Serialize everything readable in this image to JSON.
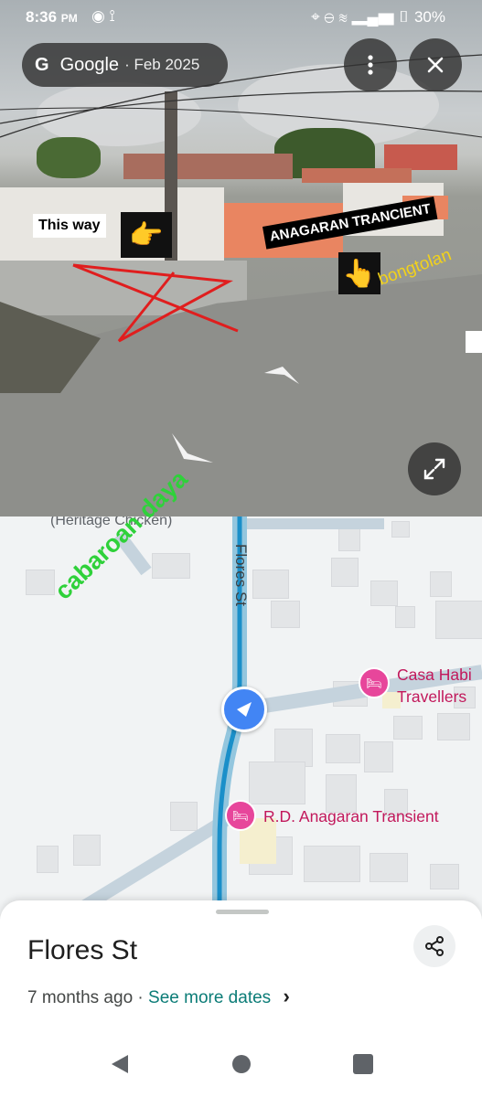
{
  "status_bar": {
    "time": "8:36",
    "ampm": "PM",
    "battery": "30%"
  },
  "street_view": {
    "brand": "Google",
    "date": "· Feb 2025",
    "menu_icon": "more-vertical-icon",
    "close_icon": "close-icon",
    "fullscreen_icon": "expand-icon",
    "annotations": {
      "this_way": "This way",
      "anagaran": "ANAGARAN TRANCIENT",
      "bongtolan": "bongtolan",
      "cabaroan": "cabaroan daya"
    }
  },
  "map": {
    "street_label": "Flores St",
    "heritage_label": "(Heritage Chicken)",
    "poi_casa_line1": "Casa Habi",
    "poi_casa_line2": "Travellers",
    "poi_rd": "R.D. Anagaran Transient",
    "colors": {
      "route": "#1a8fc9",
      "poi": "#c2185b",
      "locator": "#4285f4"
    }
  },
  "sheet": {
    "title": "Flores St",
    "age": "7 months ago",
    "dot": "·",
    "see_more": "See more dates",
    "chevron": "›"
  },
  "nav": {
    "back_icon": "back-triangle-icon",
    "home_icon": "home-circle-icon",
    "recents_icon": "recents-square-icon"
  }
}
